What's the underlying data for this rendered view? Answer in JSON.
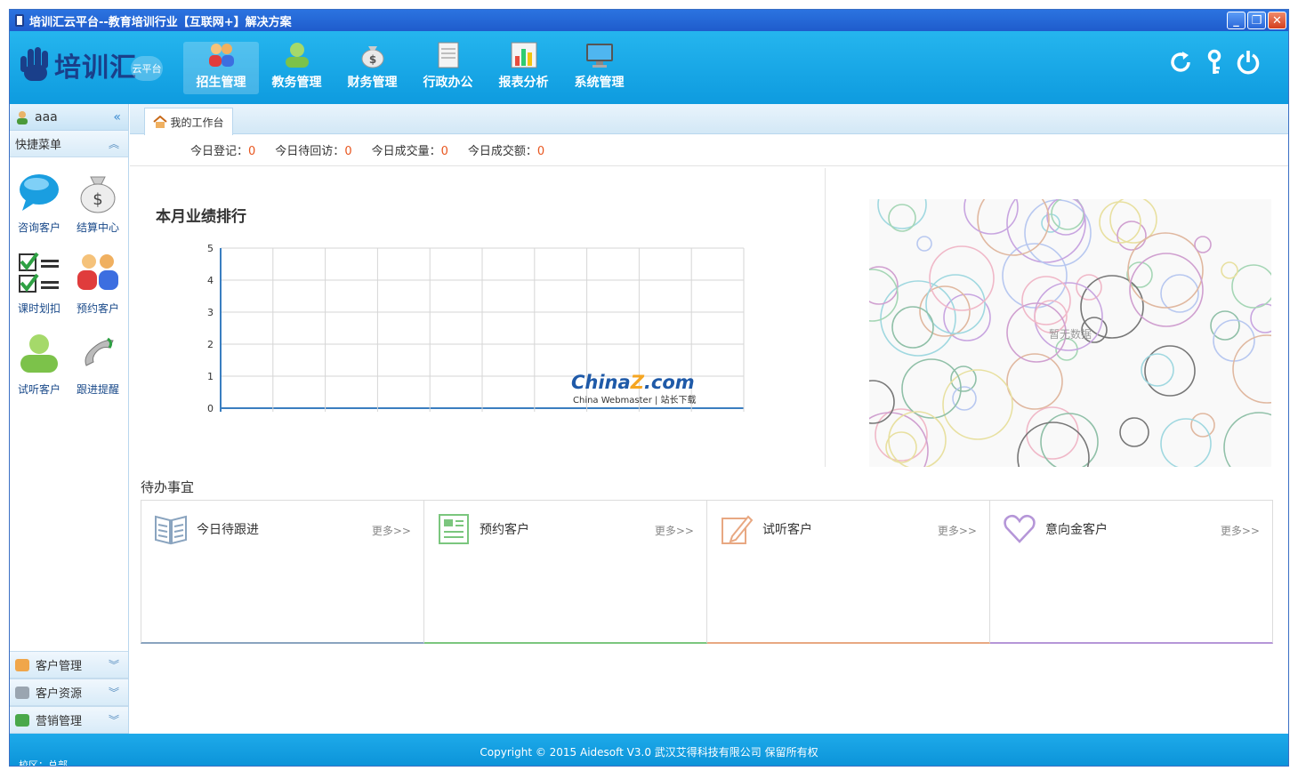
{
  "window": {
    "title": "培训汇云平台--教育培训行业【互联网+】解决方案",
    "controls": {
      "minimize": "_",
      "restore": "❐",
      "close": "✕"
    }
  },
  "header": {
    "logo_text": "培训汇",
    "logo_sub": "云平台",
    "nav": [
      {
        "label": "招生管理",
        "icon": "students-icon",
        "active": true
      },
      {
        "label": "教务管理",
        "icon": "teacher-icon",
        "active": false
      },
      {
        "label": "财务管理",
        "icon": "money-bag-icon",
        "active": false
      },
      {
        "label": "行政办公",
        "icon": "document-icon",
        "active": false
      },
      {
        "label": "报表分析",
        "icon": "bar-chart-icon",
        "active": false
      },
      {
        "label": "系统管理",
        "icon": "monitor-icon",
        "active": false
      }
    ],
    "actions": {
      "refresh": "↻",
      "key": "⚷",
      "power": "⏻"
    }
  },
  "sidebar": {
    "user": "aaa",
    "collapse": "«",
    "quick_menu": "快捷菜单",
    "quick_items": [
      {
        "label": "咨询客户",
        "icon": "chat-bubble-icon"
      },
      {
        "label": "结算中心",
        "icon": "money-bag-icon"
      },
      {
        "label": "课时划扣",
        "icon": "checklist-icon"
      },
      {
        "label": "预约客户",
        "icon": "people-icon"
      },
      {
        "label": "试听客户",
        "icon": "user-group-icon"
      },
      {
        "label": "跟进提醒",
        "icon": "phone-icon"
      }
    ],
    "bottom_sections": [
      {
        "label": "客户管理",
        "icon": "customers-icon"
      },
      {
        "label": "客户资源",
        "icon": "database-icon"
      },
      {
        "label": "营销管理",
        "icon": "grid-icon"
      }
    ]
  },
  "tabs": {
    "home": "我的工作台"
  },
  "stats": [
    {
      "label": "今日登记：",
      "value": "0"
    },
    {
      "label": "今日待回访：",
      "value": "0"
    },
    {
      "label": "今日成交量：",
      "value": "0"
    },
    {
      "label": "今日成交额：",
      "value": "0"
    }
  ],
  "chart_data": {
    "type": "bar",
    "title": "本月业绩排行",
    "categories": [],
    "values": [],
    "ylim": [
      0,
      5
    ],
    "yticks": [
      0,
      1,
      2,
      3,
      4,
      5
    ],
    "grid": true,
    "watermark": {
      "brand_a": "China",
      "brand_b": "Z",
      "brand_c": ".com",
      "sub": "China Webmaster | 站长下载"
    }
  },
  "bubble_panel": {
    "nodata": "暂无数据"
  },
  "todo": {
    "title": "待办事宜",
    "cards": [
      {
        "label": "今日待跟进",
        "more": "更多>>",
        "icon": "book-icon",
        "color": "#8aa4bf"
      },
      {
        "label": "预约客户",
        "more": "更多>>",
        "icon": "form-icon",
        "color": "#7bc67e"
      },
      {
        "label": "试听客户",
        "more": "更多>>",
        "icon": "pencil-icon",
        "color": "#e8a882"
      },
      {
        "label": "意向金客户",
        "more": "更多>>",
        "icon": "heart-icon",
        "color": "#b596d8"
      }
    ]
  },
  "footer": {
    "copyright": "Copyright © 2015 Aidesoft V3.0 武汉艾得科技有限公司  保留所有权",
    "campus": "校区：总部"
  }
}
